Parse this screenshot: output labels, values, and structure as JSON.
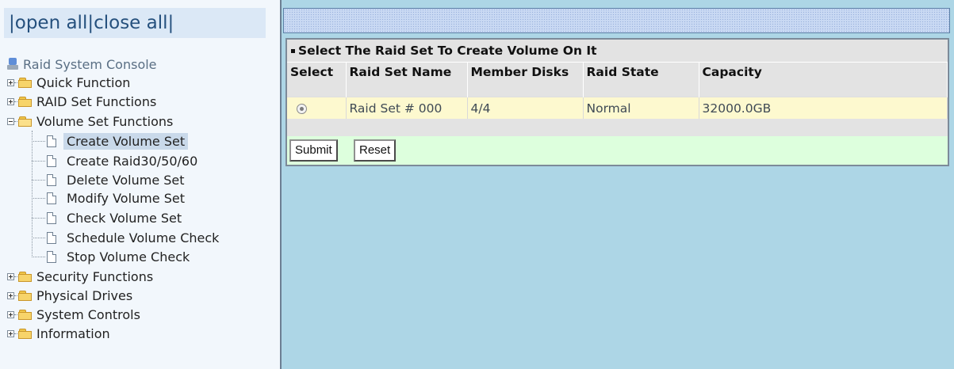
{
  "nav": {
    "open_all": "open all",
    "close_all": "close all",
    "separator": "|",
    "root": "Raid System Console",
    "groups": [
      {
        "label": "Quick Function"
      },
      {
        "label": "RAID Set Functions"
      },
      {
        "label": "Volume Set Functions"
      },
      {
        "label": "Security Functions"
      },
      {
        "label": "Physical Drives"
      },
      {
        "label": "System Controls"
      },
      {
        "label": "Information"
      }
    ],
    "volume_items": [
      {
        "label": "Create Volume Set"
      },
      {
        "label": "Create Raid30/50/60"
      },
      {
        "label": "Delete Volume Set"
      },
      {
        "label": "Modify Volume Set"
      },
      {
        "label": "Check Volume Set"
      },
      {
        "label": "Schedule Volume Check"
      },
      {
        "label": "Stop Volume Check"
      }
    ],
    "selected": "Create Volume Set"
  },
  "panel": {
    "title": "Select The Raid Set To Create Volume On It",
    "columns": [
      "Select",
      "Raid Set Name",
      "Member Disks",
      "Raid State",
      "Capacity"
    ],
    "rows": [
      {
        "selected": true,
        "name": "Raid Set # 000",
        "member_disks": "4/4",
        "state": "Normal",
        "capacity": "32000.0GB"
      }
    ],
    "submit_label": "Submit",
    "reset_label": "Reset"
  },
  "colors": {
    "content_bg": "#add6e6",
    "row_bg": "#fdf9cf",
    "button_row_bg": "#ddffdd",
    "header_bg": "#e3e3e3"
  }
}
